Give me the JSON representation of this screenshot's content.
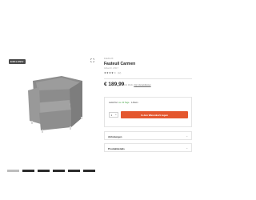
{
  "product": {
    "badge": "EXKLUSIV",
    "brand": "FLEXLUX",
    "title": "Fauteuil Carmen",
    "article_no": "Artikel-Nr. 23417",
    "stars": "★★★★☆",
    "rating_count": "(12)",
    "price": "€ 189,99",
    "price_info_prefix": "inkl. MwSt.",
    "price_info_link": "zzgl. Versandkosten",
    "delivery_prefix": "Lieferfrist:",
    "delivery_status": "ca. 20 Tage",
    "delivery_suffix": "· 1-Mann",
    "quantity": "1",
    "cart_button": "In den Warenkorb legen"
  },
  "accordions": [
    {
      "label": "Abholungen"
    },
    {
      "label": "Produktdetails"
    }
  ],
  "colors": {
    "accent": "#e4572e",
    "badge": "#4a4a4a",
    "chair": "#8a8a8a"
  },
  "icons": [
    "expand-icon",
    "chevron-down-icon"
  ]
}
